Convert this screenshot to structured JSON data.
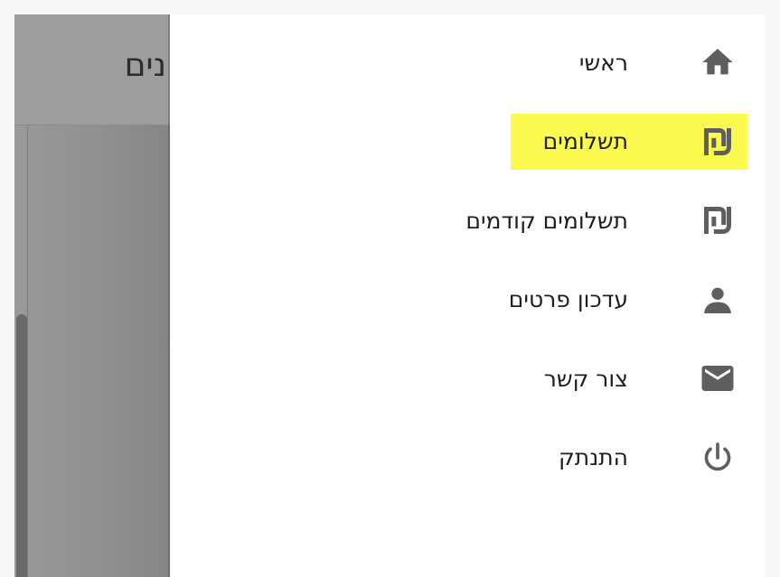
{
  "backdrop": {
    "title_fragment": "נים"
  },
  "drawer": {
    "items": [
      {
        "label": "ראשי",
        "icon": "home-icon",
        "active": false
      },
      {
        "label": "תשלומים",
        "icon": "shekel-icon",
        "active": true
      },
      {
        "label": "תשלומים קודמים",
        "icon": "shekel-icon",
        "active": false
      },
      {
        "label": "עדכון פרטים",
        "icon": "person-icon",
        "active": false
      },
      {
        "label": "צור קשר",
        "icon": "mail-icon",
        "active": false
      },
      {
        "label": "התנתק",
        "icon": "power-icon",
        "active": false
      }
    ]
  },
  "colors": {
    "active_highlight": "#fbfb4f",
    "icon_color": "#5f5f5f",
    "text_color": "#1e1e1e",
    "backdrop": "#9a9a9a"
  }
}
